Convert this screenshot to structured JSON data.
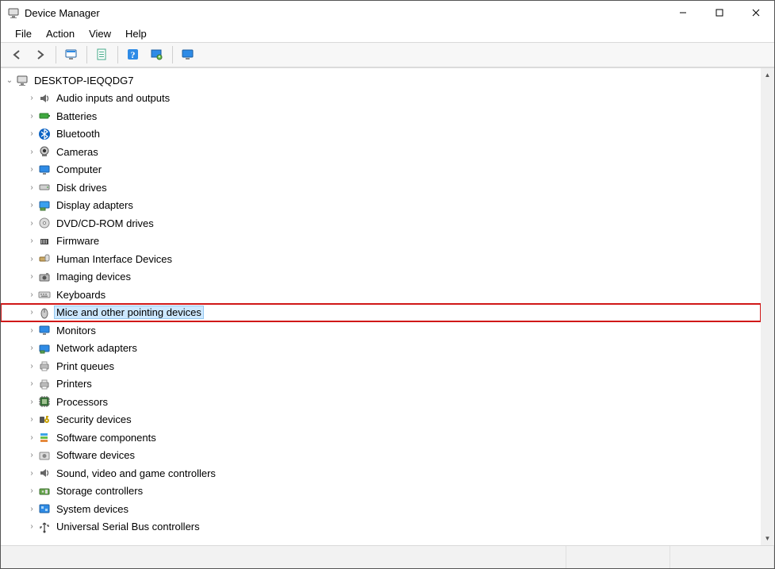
{
  "window": {
    "title": "Device Manager"
  },
  "menus": {
    "file": "File",
    "action": "Action",
    "view": "View",
    "help": "Help"
  },
  "tree": {
    "root": {
      "label": "DESKTOP-IEQQDG7",
      "expanded": true
    },
    "categories": [
      {
        "id": "audio",
        "label": "Audio inputs and outputs"
      },
      {
        "id": "batteries",
        "label": "Batteries"
      },
      {
        "id": "bluetooth",
        "label": "Bluetooth"
      },
      {
        "id": "cameras",
        "label": "Cameras"
      },
      {
        "id": "computer",
        "label": "Computer"
      },
      {
        "id": "disk",
        "label": "Disk drives"
      },
      {
        "id": "display",
        "label": "Display adapters"
      },
      {
        "id": "dvd",
        "label": "DVD/CD-ROM drives"
      },
      {
        "id": "firmware",
        "label": "Firmware"
      },
      {
        "id": "hid",
        "label": "Human Interface Devices"
      },
      {
        "id": "imaging",
        "label": "Imaging devices"
      },
      {
        "id": "keyboards",
        "label": "Keyboards"
      },
      {
        "id": "mice",
        "label": "Mice and other pointing devices",
        "selected": true,
        "highlighted": true
      },
      {
        "id": "monitors",
        "label": "Monitors"
      },
      {
        "id": "network",
        "label": "Network adapters"
      },
      {
        "id": "printq",
        "label": "Print queues"
      },
      {
        "id": "printers",
        "label": "Printers"
      },
      {
        "id": "cpu",
        "label": "Processors"
      },
      {
        "id": "security",
        "label": "Security devices"
      },
      {
        "id": "swcomp",
        "label": "Software components"
      },
      {
        "id": "swdev",
        "label": "Software devices"
      },
      {
        "id": "sound",
        "label": "Sound, video and game controllers"
      },
      {
        "id": "storage",
        "label": "Storage controllers"
      },
      {
        "id": "system",
        "label": "System devices"
      },
      {
        "id": "usb",
        "label": "Universal Serial Bus controllers"
      }
    ]
  },
  "icons": {
    "app": "computer-tree",
    "audio": "speaker",
    "batteries": "battery",
    "bluetooth": "bluetooth",
    "cameras": "webcam",
    "computer": "monitor",
    "disk": "hdd",
    "display": "monitor-card",
    "dvd": "disc",
    "firmware": "chip-bars",
    "hid": "hid",
    "imaging": "camera",
    "keyboards": "keyboard",
    "mice": "mouse",
    "monitors": "monitor",
    "network": "nic",
    "printq": "printer",
    "printers": "printer",
    "cpu": "chip",
    "security": "key",
    "swcomp": "stack",
    "swdev": "gear-box",
    "sound": "speaker",
    "storage": "controller",
    "system": "board",
    "usb": "usb"
  }
}
